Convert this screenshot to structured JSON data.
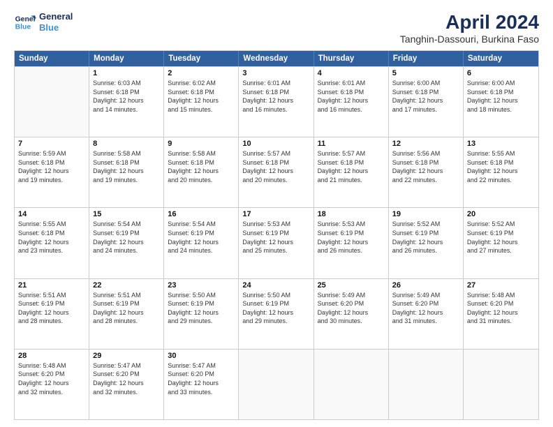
{
  "header": {
    "logo_line1": "General",
    "logo_line2": "Blue",
    "title": "April 2024",
    "subtitle": "Tanghin-Dassouri, Burkina Faso"
  },
  "weekdays": [
    "Sunday",
    "Monday",
    "Tuesday",
    "Wednesday",
    "Thursday",
    "Friday",
    "Saturday"
  ],
  "weeks": [
    [
      {
        "day": "",
        "text": ""
      },
      {
        "day": "1",
        "text": "Sunrise: 6:03 AM\nSunset: 6:18 PM\nDaylight: 12 hours\nand 14 minutes."
      },
      {
        "day": "2",
        "text": "Sunrise: 6:02 AM\nSunset: 6:18 PM\nDaylight: 12 hours\nand 15 minutes."
      },
      {
        "day": "3",
        "text": "Sunrise: 6:01 AM\nSunset: 6:18 PM\nDaylight: 12 hours\nand 16 minutes."
      },
      {
        "day": "4",
        "text": "Sunrise: 6:01 AM\nSunset: 6:18 PM\nDaylight: 12 hours\nand 16 minutes."
      },
      {
        "day": "5",
        "text": "Sunrise: 6:00 AM\nSunset: 6:18 PM\nDaylight: 12 hours\nand 17 minutes."
      },
      {
        "day": "6",
        "text": "Sunrise: 6:00 AM\nSunset: 6:18 PM\nDaylight: 12 hours\nand 18 minutes."
      }
    ],
    [
      {
        "day": "7",
        "text": "Sunrise: 5:59 AM\nSunset: 6:18 PM\nDaylight: 12 hours\nand 19 minutes."
      },
      {
        "day": "8",
        "text": "Sunrise: 5:58 AM\nSunset: 6:18 PM\nDaylight: 12 hours\nand 19 minutes."
      },
      {
        "day": "9",
        "text": "Sunrise: 5:58 AM\nSunset: 6:18 PM\nDaylight: 12 hours\nand 20 minutes."
      },
      {
        "day": "10",
        "text": "Sunrise: 5:57 AM\nSunset: 6:18 PM\nDaylight: 12 hours\nand 20 minutes."
      },
      {
        "day": "11",
        "text": "Sunrise: 5:57 AM\nSunset: 6:18 PM\nDaylight: 12 hours\nand 21 minutes."
      },
      {
        "day": "12",
        "text": "Sunrise: 5:56 AM\nSunset: 6:18 PM\nDaylight: 12 hours\nand 22 minutes."
      },
      {
        "day": "13",
        "text": "Sunrise: 5:55 AM\nSunset: 6:18 PM\nDaylight: 12 hours\nand 22 minutes."
      }
    ],
    [
      {
        "day": "14",
        "text": "Sunrise: 5:55 AM\nSunset: 6:18 PM\nDaylight: 12 hours\nand 23 minutes."
      },
      {
        "day": "15",
        "text": "Sunrise: 5:54 AM\nSunset: 6:19 PM\nDaylight: 12 hours\nand 24 minutes."
      },
      {
        "day": "16",
        "text": "Sunrise: 5:54 AM\nSunset: 6:19 PM\nDaylight: 12 hours\nand 24 minutes."
      },
      {
        "day": "17",
        "text": "Sunrise: 5:53 AM\nSunset: 6:19 PM\nDaylight: 12 hours\nand 25 minutes."
      },
      {
        "day": "18",
        "text": "Sunrise: 5:53 AM\nSunset: 6:19 PM\nDaylight: 12 hours\nand 26 minutes."
      },
      {
        "day": "19",
        "text": "Sunrise: 5:52 AM\nSunset: 6:19 PM\nDaylight: 12 hours\nand 26 minutes."
      },
      {
        "day": "20",
        "text": "Sunrise: 5:52 AM\nSunset: 6:19 PM\nDaylight: 12 hours\nand 27 minutes."
      }
    ],
    [
      {
        "day": "21",
        "text": "Sunrise: 5:51 AM\nSunset: 6:19 PM\nDaylight: 12 hours\nand 28 minutes."
      },
      {
        "day": "22",
        "text": "Sunrise: 5:51 AM\nSunset: 6:19 PM\nDaylight: 12 hours\nand 28 minutes."
      },
      {
        "day": "23",
        "text": "Sunrise: 5:50 AM\nSunset: 6:19 PM\nDaylight: 12 hours\nand 29 minutes."
      },
      {
        "day": "24",
        "text": "Sunrise: 5:50 AM\nSunset: 6:19 PM\nDaylight: 12 hours\nand 29 minutes."
      },
      {
        "day": "25",
        "text": "Sunrise: 5:49 AM\nSunset: 6:20 PM\nDaylight: 12 hours\nand 30 minutes."
      },
      {
        "day": "26",
        "text": "Sunrise: 5:49 AM\nSunset: 6:20 PM\nDaylight: 12 hours\nand 31 minutes."
      },
      {
        "day": "27",
        "text": "Sunrise: 5:48 AM\nSunset: 6:20 PM\nDaylight: 12 hours\nand 31 minutes."
      }
    ],
    [
      {
        "day": "28",
        "text": "Sunrise: 5:48 AM\nSunset: 6:20 PM\nDaylight: 12 hours\nand 32 minutes."
      },
      {
        "day": "29",
        "text": "Sunrise: 5:47 AM\nSunset: 6:20 PM\nDaylight: 12 hours\nand 32 minutes."
      },
      {
        "day": "30",
        "text": "Sunrise: 5:47 AM\nSunset: 6:20 PM\nDaylight: 12 hours\nand 33 minutes."
      },
      {
        "day": "",
        "text": ""
      },
      {
        "day": "",
        "text": ""
      },
      {
        "day": "",
        "text": ""
      },
      {
        "day": "",
        "text": ""
      }
    ]
  ]
}
